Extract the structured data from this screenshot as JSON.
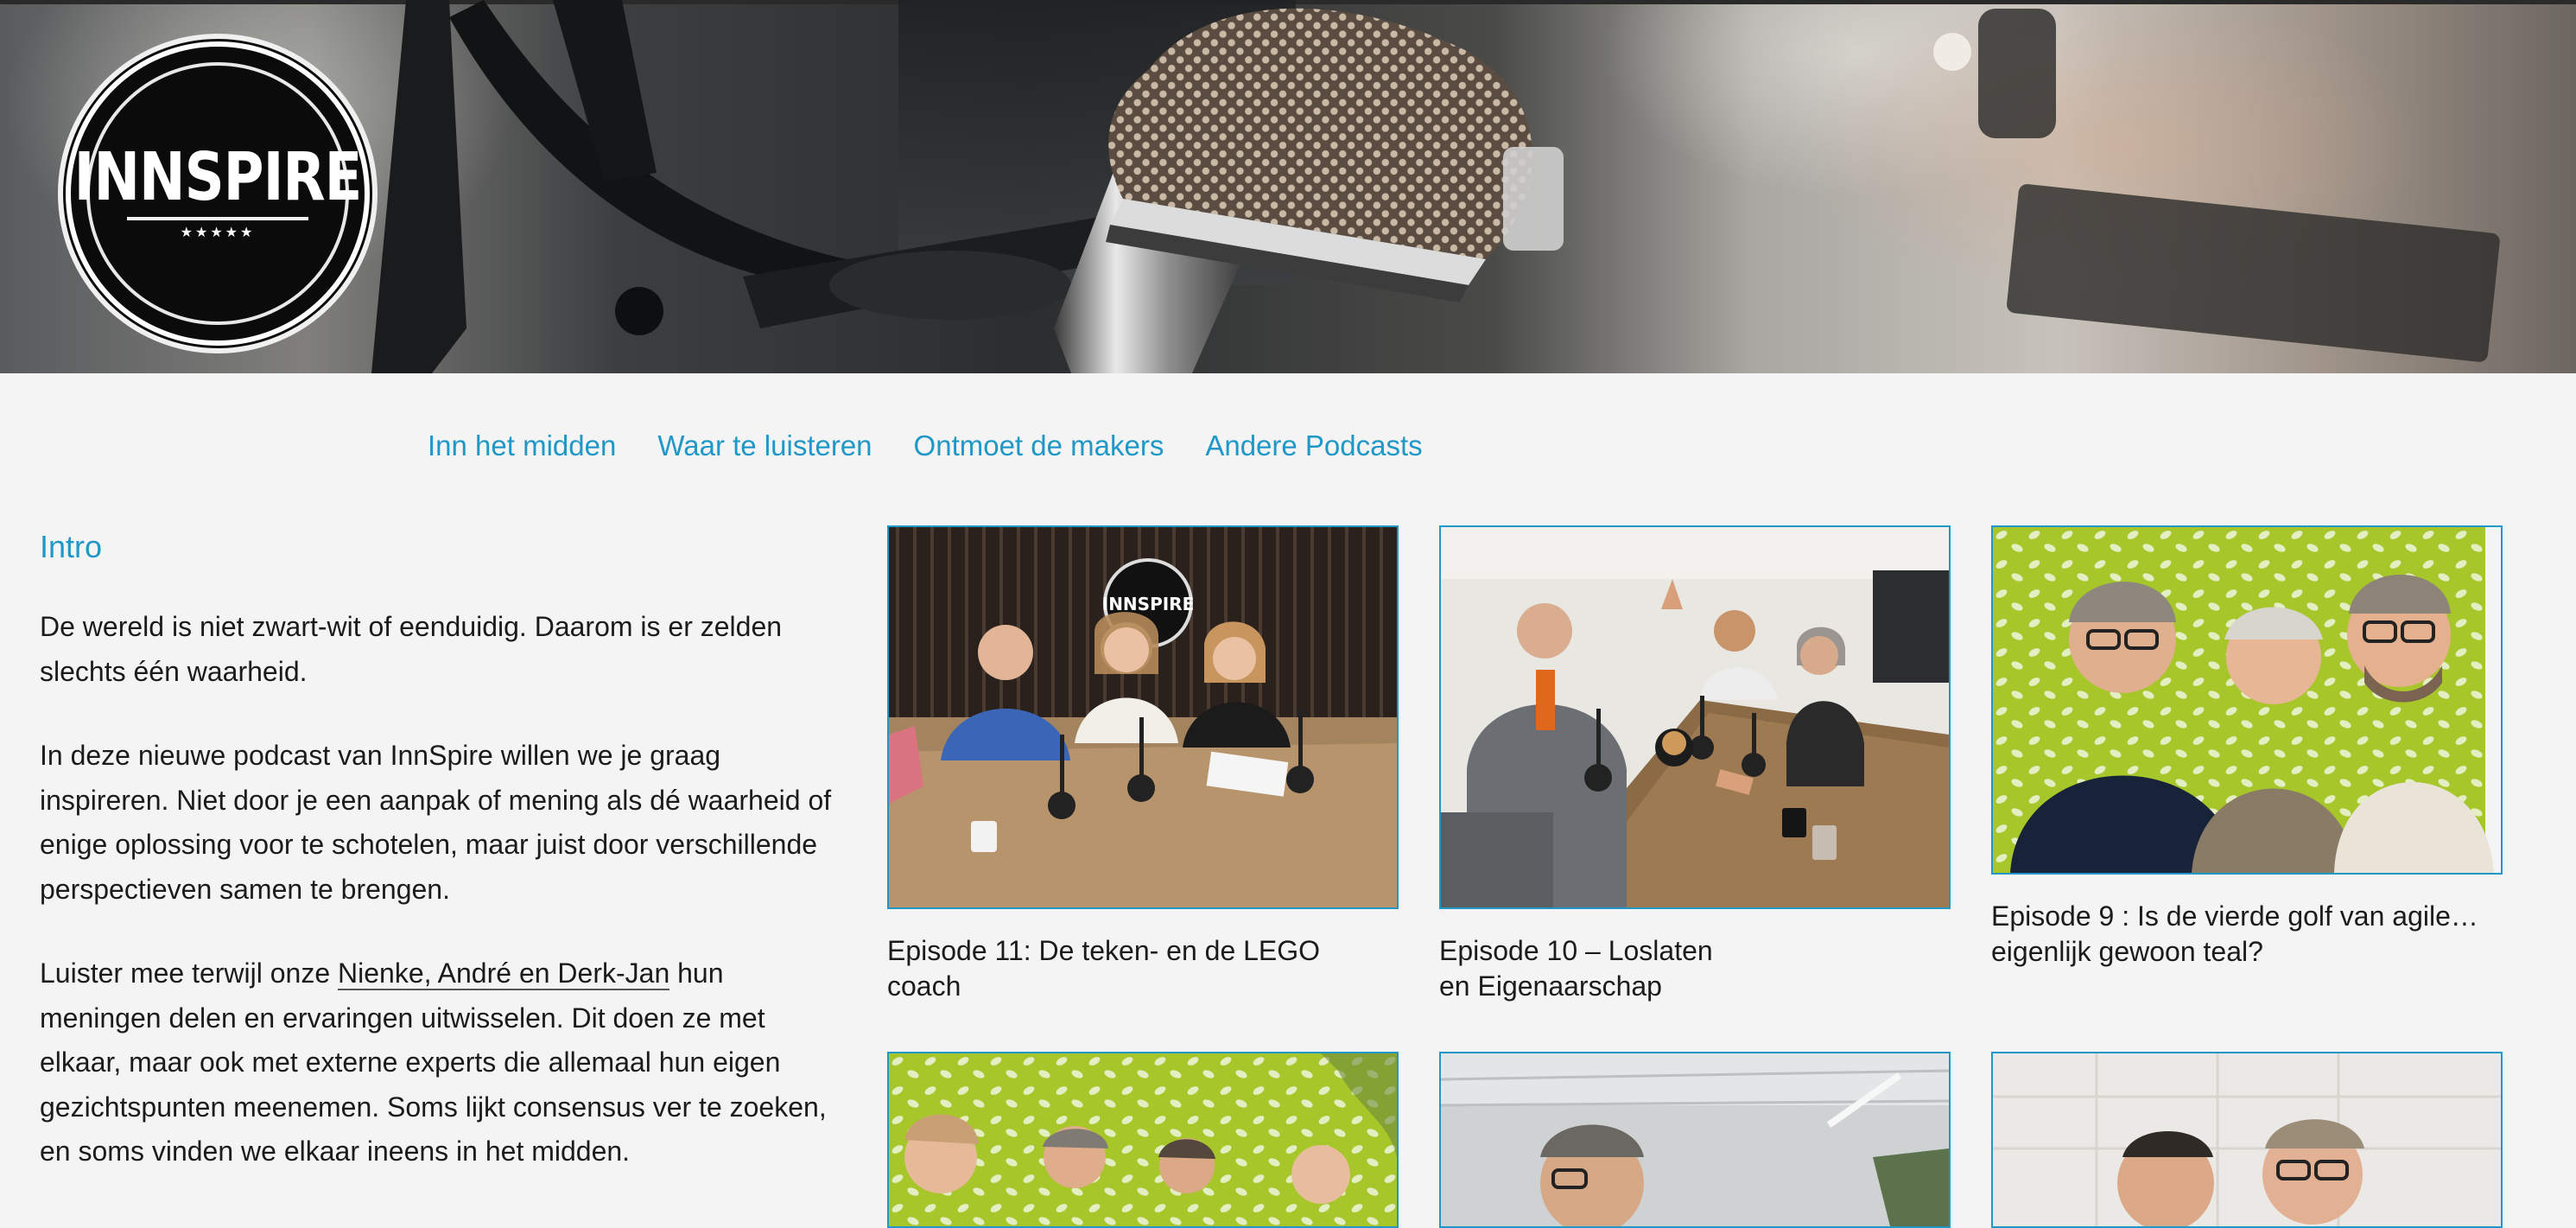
{
  "header": {
    "logo": {
      "text": "INNSPIRE",
      "stars": "★★★★★"
    }
  },
  "nav": {
    "items": [
      {
        "label": "Inn het midden"
      },
      {
        "label": "Waar te luisteren"
      },
      {
        "label": "Ontmoet de makers"
      },
      {
        "label": "Andere Podcasts"
      }
    ]
  },
  "intro": {
    "heading": "Intro",
    "p1": "De wereld is niet zwart-wit of eenduidig. Daarom is er zelden slechts één waarheid.",
    "p2": "In deze nieuwe podcast van InnSpire willen we je graag inspireren. Niet door je een aanpak of mening als dé waarheid of enige oplossing voor te schotelen, maar juist door verschillende perspectieven samen te brengen.",
    "p3_before": "Luister mee terwijl onze ",
    "p3_link": "Nienke, André en Derk-Jan",
    "p3_after": " hun meningen delen en ervaringen uitwisselen. Dit doen ze met elkaar, maar ook met externe experts die allemaal hun eigen gezichtspunten meenemen. Soms lijkt consensus ver te zoeken, en soms vinden we elkaar ineens in het midden."
  },
  "episodes": [
    {
      "title": "Episode 11: De teken- en de LEGO coach"
    },
    {
      "title_line1": "Episode 10 – Loslaten",
      "title_line2": "en Eigenaarschap"
    },
    {
      "title_line1": "Episode 9 : Is de vierde golf van agile…",
      "title_line2": "eigenlijk gewoon teal?"
    }
  ],
  "colors": {
    "accent": "#1f98c8",
    "background": "#f4f4f4",
    "text": "#1b1b1b",
    "lime_wall": "#a7c62a"
  }
}
